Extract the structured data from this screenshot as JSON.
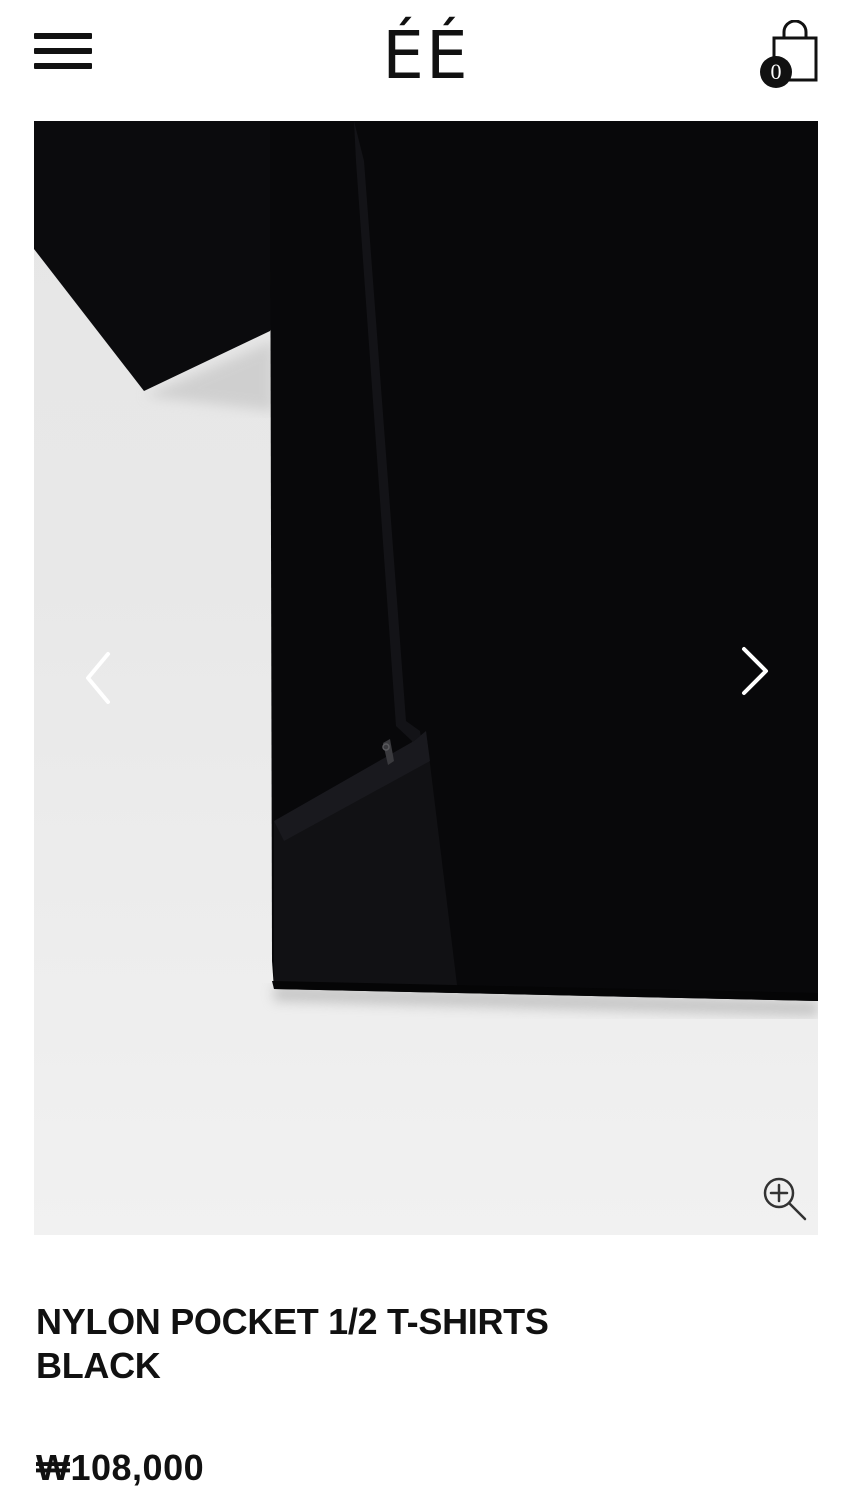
{
  "header": {
    "logo_text": "ÉÉ",
    "menu_icon": "hamburger-menu-icon",
    "cart_icon": "shopping-bag-icon",
    "cart_count": "0"
  },
  "gallery": {
    "prev_icon": "chevron-left-icon",
    "next_icon": "chevron-right-icon",
    "zoom_icon": "zoom-in-icon"
  },
  "product": {
    "name_line1": "NYLON POCKET 1/2 T-SHIRTS",
    "name_line2": "BLACK",
    "price": "₩108,000"
  },
  "colors": {
    "text": "#111111",
    "background": "#ffffff",
    "photo_background": "#e8e8e8",
    "garment": "#0a0a0c"
  }
}
